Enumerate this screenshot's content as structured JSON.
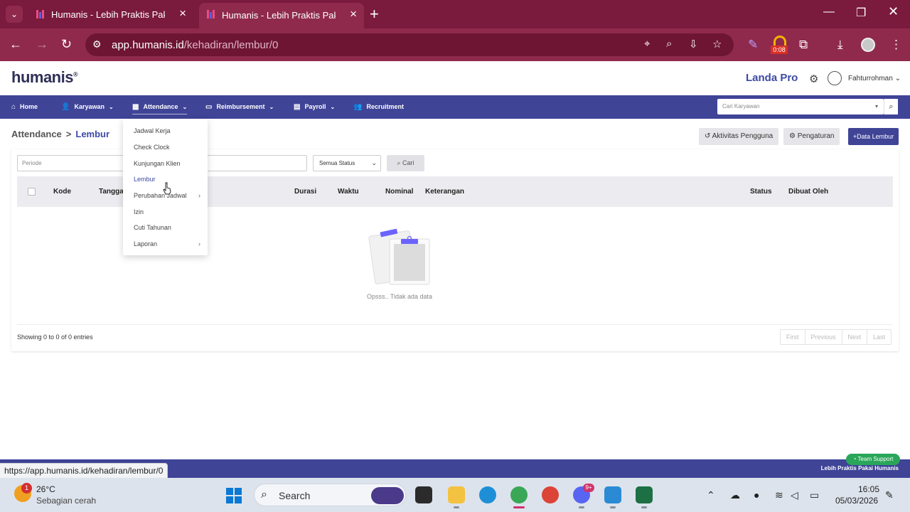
{
  "browser": {
    "tabs": [
      {
        "title": "Humanis - Lebih Praktis Pakai Humanis",
        "active": false
      },
      {
        "title": "Humanis - Lebih Praktis Pakai Humanis",
        "active": true
      }
    ],
    "url_host": "app.humanis.id",
    "url_path": "/kehadiran/lembur/0",
    "extension_timer": "0:08",
    "status_url": "https://app.humanis.id/kehadiran/lembur/0"
  },
  "header": {
    "logo": "humanis",
    "company": "Landa Pro",
    "user_name": "Fahturrohman"
  },
  "nav": {
    "items": [
      {
        "label": "Home",
        "icon": "home-icon"
      },
      {
        "label": "Karyawan",
        "icon": "user-check-icon"
      },
      {
        "label": "Attendance",
        "icon": "calendar-icon"
      },
      {
        "label": "Reimbursement",
        "icon": "money-icon"
      },
      {
        "label": "Payroll",
        "icon": "wallet-icon"
      },
      {
        "label": "Recruitment",
        "icon": "users-icon"
      }
    ],
    "search_placeholder": "Cari Karyawan"
  },
  "dropdown": {
    "items": [
      {
        "label": "Jadwal Kerja",
        "submenu": false,
        "active": false
      },
      {
        "label": "Check Clock",
        "submenu": false,
        "active": false
      },
      {
        "label": "Kunjungan Klien",
        "submenu": false,
        "active": false
      },
      {
        "label": "Lembur",
        "submenu": false,
        "active": true
      },
      {
        "label": "Perubahan Jadwal",
        "submenu": true,
        "active": false
      },
      {
        "label": "Izin",
        "submenu": false,
        "active": false
      },
      {
        "label": "Cuti Tahunan",
        "submenu": false,
        "active": false
      },
      {
        "label": "Laporan",
        "submenu": true,
        "active": false
      }
    ]
  },
  "page": {
    "breadcrumb_parent": "Attendance",
    "breadcrumb_current": "Lembur",
    "actions": {
      "activity": "Aktivitas Pengguna",
      "settings": "Pengaturan",
      "add": "Data Lembur"
    },
    "filters": {
      "period_placeholder": "Periode",
      "status_value": "Semua Status",
      "search_button": "Cari"
    },
    "table_headers": [
      "Kode",
      "Tanggal",
      "Durasi",
      "Waktu",
      "Nominal",
      "Keterangan",
      "Status",
      "Dibuat Oleh"
    ],
    "empty_message": "Opsss.. Tidak ada data",
    "showing": "Showing 0 to 0 of 0 entries",
    "pagination": [
      "First",
      "Previous",
      "Next",
      "Last"
    ]
  },
  "footer": {
    "tagline": "Lebih Praktis Pakai Humanis",
    "support": "Team Support"
  },
  "taskbar": {
    "temperature": "26°C",
    "weather": "Sebagian cerah",
    "weather_badge": "1",
    "search_label": "Search",
    "discord_badge": "9+",
    "time": "16:05",
    "date": "05/03/2026"
  },
  "colors": {
    "browser_frame": "#8f2a4d",
    "nav_bar": "#3f4497",
    "accent_text": "#3d4aa3"
  }
}
